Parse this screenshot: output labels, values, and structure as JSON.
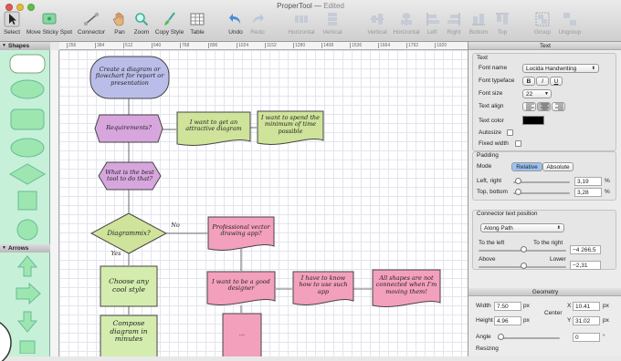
{
  "window": {
    "title": "ProperTool",
    "status": "Edited"
  },
  "toolbar": {
    "select": "Select",
    "move_sticky": "Move Sticky Spot",
    "connector": "Connector",
    "pan": "Pan",
    "zoom": "Zoom",
    "copy_style": "Copy Style",
    "table": "Table",
    "undo": "Undo",
    "redo": "Redo",
    "horizontal": "Horizontal",
    "vertical": "Vertical",
    "al_vertical": "Vertical",
    "al_horizontal": "Horizontal",
    "left": "Left",
    "right": "Right",
    "bottom": "Bottom",
    "top": "Top",
    "group": "Group",
    "ungroup": "Ungroup"
  },
  "ruler": {
    "ticks": [
      "256",
      "384",
      "512",
      "640",
      "768",
      "896",
      "1024",
      "1152",
      "1280",
      "1408",
      "1536",
      "1664",
      "1792",
      "1920"
    ]
  },
  "sidebar": {
    "shapes_title": "Shapes",
    "arrows_title": "Arrows"
  },
  "canvas": {
    "n1": "Create a diagram or flowchart for report or presentation",
    "n2": "Requirements?",
    "n3": "I want to get an attractive diagram",
    "n4": "I want to spend the minimum of time possible",
    "n5": "What is the best tool to do that?",
    "n6": "Diagrammix?",
    "no": "No",
    "yes": "Yes",
    "n7": "Professional vector drawing app?",
    "n8": "Choose any cool style",
    "n9": "I want to be a good designer",
    "n10": "I have to know how to use such app",
    "n11": "All shapes are not connected when I'm moving them!",
    "n12": "Compose diagram in minutes",
    "n13": "..."
  },
  "inspector": {
    "title": "Text",
    "text_group": "Text",
    "font_name_label": "Font name",
    "font_name": "Lucida Handwriting",
    "font_typeface_label": "Font typeface",
    "bold": "B",
    "italic": "I",
    "underline": "U",
    "font_size_label": "Font size",
    "font_size": "22",
    "text_align_label": "Text align",
    "text_color_label": "Text color",
    "text_color": "#000000",
    "autosize_label": "Autosize",
    "fixed_width_label": "Fixed width",
    "padding_group": "Padding",
    "mode_label": "Mode",
    "relative": "Relative",
    "absolute": "Absolute",
    "left_right_label": "Left, right",
    "left_right": "3,19",
    "pct1": "%",
    "top_bottom_label": "Top, bottom",
    "top_bottom": "3,28",
    "pct2": "%",
    "connector_group": "Connector text position",
    "along_path": "Along Path",
    "to_left": "To the left",
    "to_right": "To the right",
    "lr_value": "−4 266,5",
    "above": "Above",
    "lower": "Lower",
    "al_value": "−2,31",
    "geometry_title": "Geometry",
    "width_label": "Width",
    "width": "7.50",
    "w_unit": "px",
    "height_label": "Height",
    "height": "4.96",
    "h_unit": "px",
    "x_label": "X",
    "x": "10.41",
    "x_unit": "px",
    "y_label": "Y",
    "y": "31.02",
    "y_unit": "px",
    "center": "Center",
    "angle_label": "Angle",
    "angle": "0",
    "deg": "°",
    "resizing": "Resizing"
  },
  "colors": {
    "sidebar": "#c7f0d8",
    "purple": "#d7a6dd",
    "green": "#cfe39a",
    "pink": "#f3a0bd",
    "lightgreen": "#d4edae",
    "blue": "#bbbde9",
    "accent": "#3b7de0"
  }
}
